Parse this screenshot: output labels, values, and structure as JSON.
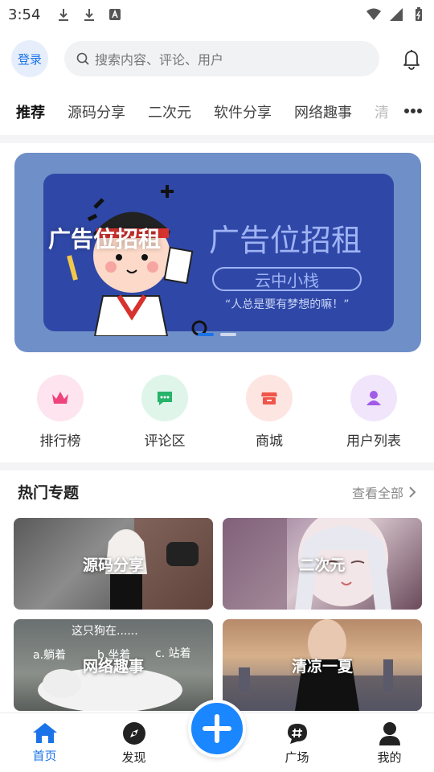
{
  "status_bar": {
    "time": "3:54"
  },
  "header": {
    "login_label": "登录",
    "search_placeholder": "搜索内容、评论、用户"
  },
  "tabs": [
    {
      "label": "推荐",
      "active": true
    },
    {
      "label": "源码分享"
    },
    {
      "label": "二次元"
    },
    {
      "label": "软件分享"
    },
    {
      "label": "网络趣事"
    },
    {
      "label": "清"
    }
  ],
  "banner": {
    "left_text": "广告位招租",
    "title": "广告位招租",
    "pill": "云中小栈",
    "subtitle": "“人总是要有梦想的嘛！”",
    "slide_count": 2,
    "active_slide": 1
  },
  "quick_menu": [
    {
      "label": "排行榜",
      "icon": "crown-icon",
      "bg": "#fde4ef",
      "color": "#f0437c"
    },
    {
      "label": "评论区",
      "icon": "comment-icon",
      "bg": "#dff5ea",
      "color": "#26b36a"
    },
    {
      "label": "商城",
      "icon": "shop-icon",
      "bg": "#fde5e2",
      "color": "#f0554a"
    },
    {
      "label": "用户列表",
      "icon": "user-icon",
      "bg": "#f1e5fb",
      "color": "#a25be8"
    }
  ],
  "hot_topics": {
    "title": "热门专题",
    "see_all": "查看全部",
    "cards": [
      {
        "label": "源码分享"
      },
      {
        "label": "二次元"
      },
      {
        "label": "网络趣事",
        "overlay_top": "这只狗在......",
        "overlay_options": [
          "a.躺着",
          "b.坐着",
          "c. 站着"
        ]
      },
      {
        "label": "清凉一夏"
      }
    ]
  },
  "bottom_nav": [
    {
      "label": "首页",
      "icon": "home-icon",
      "active": true
    },
    {
      "label": "发现",
      "icon": "compass-icon"
    },
    {
      "label": "广场",
      "icon": "hashtag-icon"
    },
    {
      "label": "我的",
      "icon": "person-icon"
    }
  ],
  "colors": {
    "accent": "#1a73e8",
    "fab": "#1a86ff"
  }
}
